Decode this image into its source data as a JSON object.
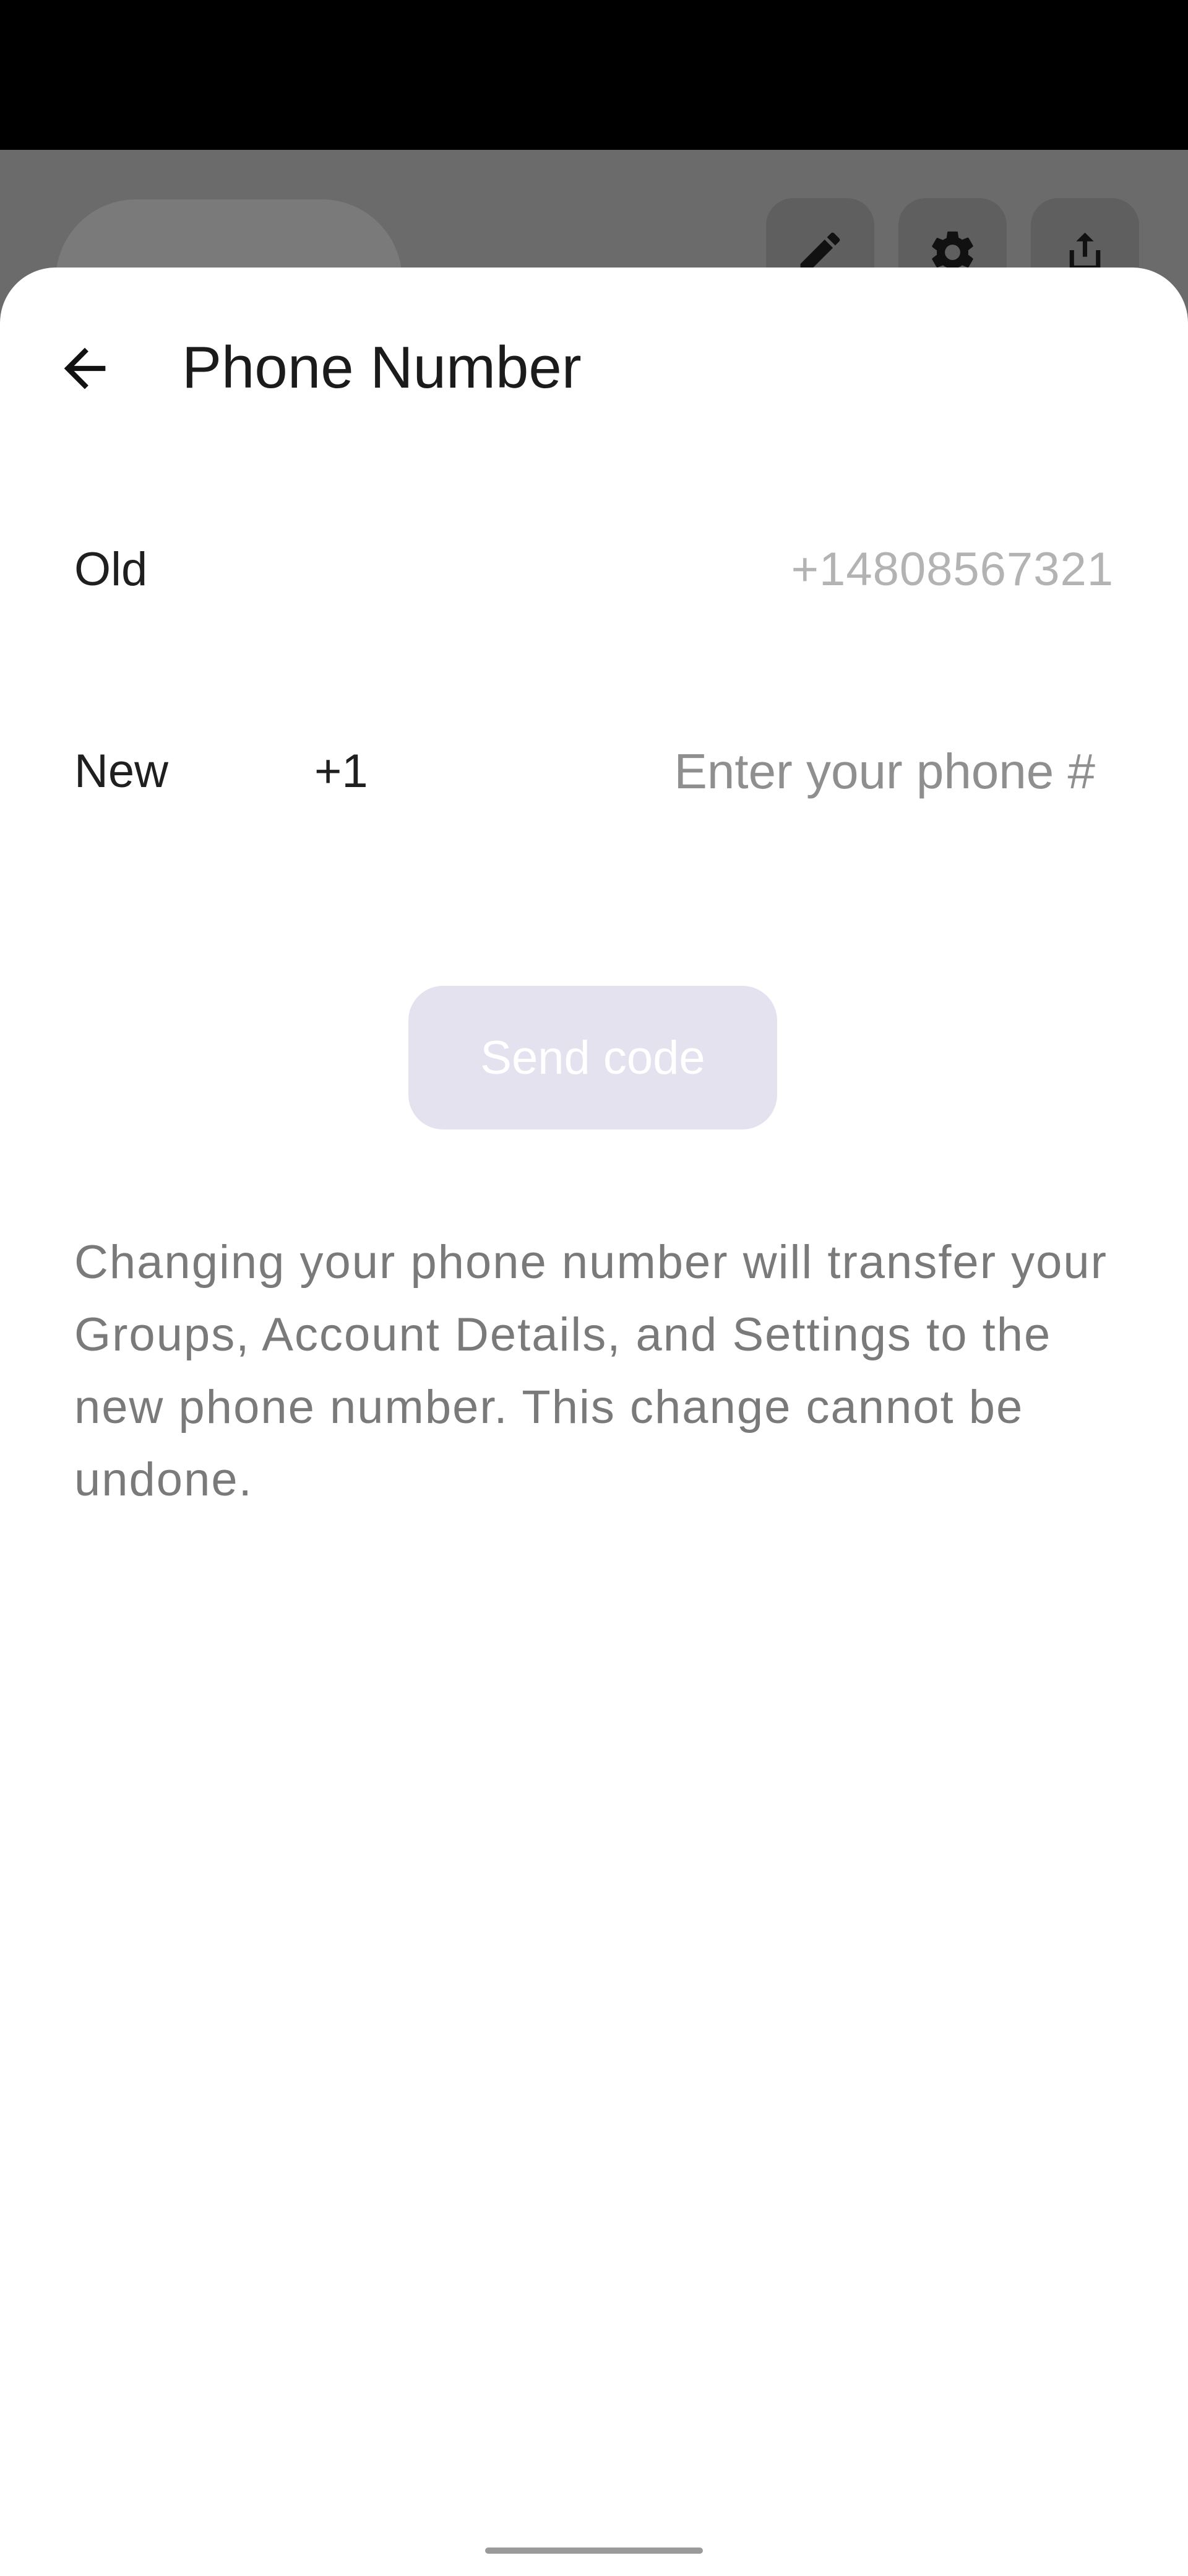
{
  "sheet": {
    "title": "Phone Number",
    "old_label": "Old",
    "old_value": "+14808567321",
    "new_label": "New",
    "country_code": "+1",
    "phone_placeholder": "Enter your phone #",
    "phone_value": "",
    "send_button_label": "Send code",
    "send_button_enabled": false,
    "info_text": "Changing your phone number will transfer your Groups, Account Details, and Settings to the new phone number. This change cannot be undone."
  },
  "icons": {
    "back": "arrow-left-icon",
    "edit": "pencil-icon",
    "settings": "gear-icon",
    "share": "share-icon"
  },
  "colors": {
    "send_button_disabled_bg": "#e4e2ef",
    "overlay": "#6b6b6b"
  }
}
